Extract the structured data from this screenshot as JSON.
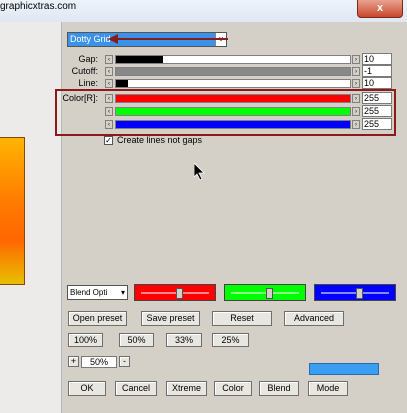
{
  "window": {
    "title_fragment": "graphicxtras.com",
    "close_glyph": "x"
  },
  "filter": {
    "selected": "Dotty Grid",
    "dropdown_arrow": "v"
  },
  "sliders": [
    {
      "label": "Gap:",
      "value": "10",
      "level": 0.2,
      "color": "#000000"
    },
    {
      "label": "Cutoff:",
      "value": "-1",
      "level": 1.0,
      "color": "#888888"
    },
    {
      "label": "Line:",
      "value": "10",
      "level": 0.05,
      "color": "#000000"
    },
    {
      "label": "Color[R]:",
      "value": "255",
      "level": 1.0,
      "color": "#ff0000"
    },
    {
      "label": "",
      "value": "255",
      "level": 1.0,
      "color": "#00ff00"
    },
    {
      "label": "",
      "value": "255",
      "level": 1.0,
      "color": "#0000ff"
    }
  ],
  "checkbox": {
    "label": "Create lines not gaps",
    "checked": true,
    "mark": "✓"
  },
  "blend": {
    "label": "Blend Opti",
    "arrow": "▾"
  },
  "color_sliders": [
    {
      "color": "#ff0000",
      "thumb": 0.55
    },
    {
      "color": "#00ff00",
      "thumb": 0.55
    },
    {
      "color": "#0000ff",
      "thumb": 0.55
    }
  ],
  "buttons_row1": [
    "Open preset",
    "Save preset",
    "Reset",
    "Advanced"
  ],
  "buttons_row2": [
    "100%",
    "50%",
    "33%",
    "25%"
  ],
  "zoom": {
    "plus": "+",
    "value": "50%",
    "minus": "-"
  },
  "buttons_row3": [
    "OK",
    "Cancel",
    "Xtreme",
    "Color",
    "Blend",
    "Mode"
  ],
  "spin": {
    "left": "‹",
    "right": "›"
  },
  "annotation": {
    "highlight_color": "#8b1a1a"
  }
}
